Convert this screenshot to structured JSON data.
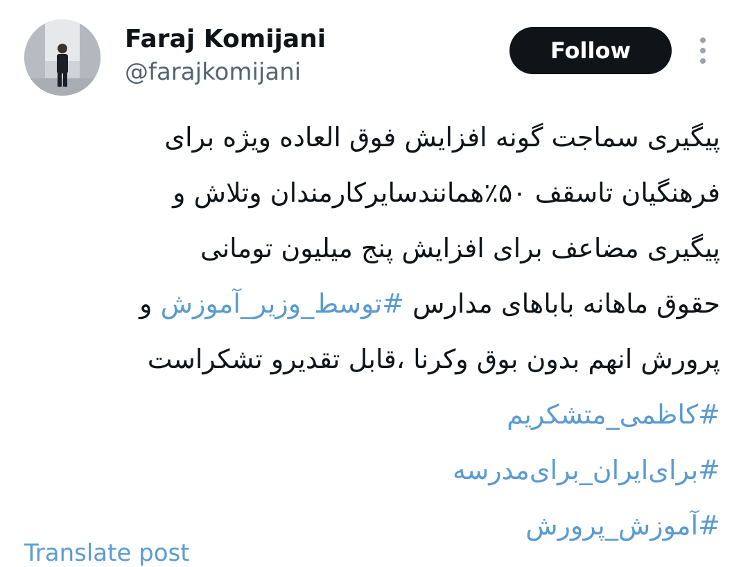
{
  "author": {
    "display_name": "Faraj Komijani",
    "handle": "@farajkomijani"
  },
  "follow_label": "Follow",
  "tweet": {
    "line1": "پیگیری سماجت گونه افزایش فوق العاده ویژه برای",
    "line2": "فرهنگیان تاسقف ۵۰٪همانندسایرکارمندان وتلاش و",
    "line3": "پیگیری مضاعف برای افزایش پنج میلیون تومانی",
    "line4_text": "حقوق ماهانه باباهای مدارس ",
    "line4_hashtag": "#توسط_وزیر_آموزش",
    "line4_tail": " و",
    "line5": "پرورش انهم بدون بوق وکرنا ،قابل تقدیرو تشکراست",
    "hashtags": [
      "#کاظمی_متشکریم",
      "#برای‌ایران_برای‌مدرسه",
      "#آموزش_پرورش"
    ]
  },
  "translate_label": "Translate post",
  "icons": {
    "more": "more-vertical-icon"
  },
  "colors": {
    "link": "#5b9bd1",
    "button_bg": "#0f1419",
    "handle": "#536471"
  }
}
